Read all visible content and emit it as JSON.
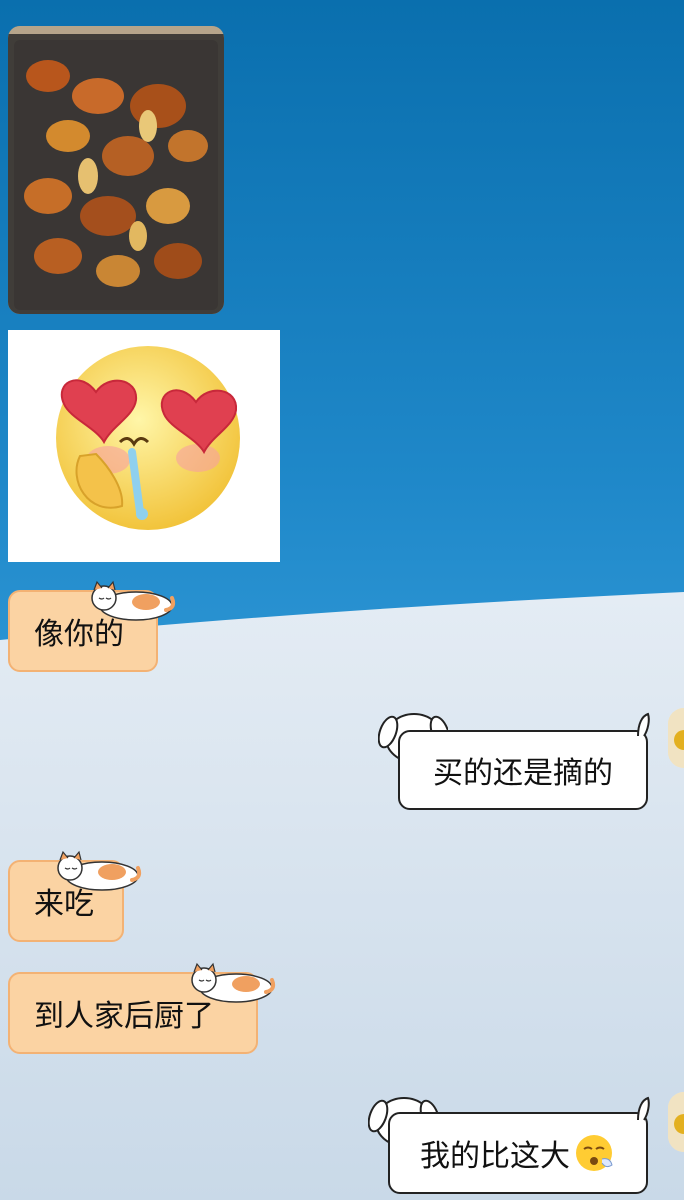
{
  "messages": [
    {
      "id": "m1",
      "side": "left",
      "type": "image",
      "desc_icon": "mushroom-photo"
    },
    {
      "id": "m2",
      "side": "left",
      "type": "sticker",
      "desc_icon": "heart-eyes-drooling-emoji"
    },
    {
      "id": "m3",
      "side": "left",
      "type": "text",
      "text": "像你的"
    },
    {
      "id": "m4",
      "side": "right",
      "type": "text",
      "text": "买的还是摘的"
    },
    {
      "id": "m5",
      "side": "left",
      "type": "text",
      "text": "来吃"
    },
    {
      "id": "m6",
      "side": "left",
      "type": "text",
      "text": "到人家后厨了"
    },
    {
      "id": "m7",
      "side": "right",
      "type": "text",
      "text": "我的比这大",
      "emoji": "😮‍💨"
    }
  ],
  "colors": {
    "left_bubble": "#fbd3a3",
    "left_border": "#f3b274",
    "right_bubble": "#ffffff",
    "right_border": "#222222",
    "sky": "#1f88c9"
  }
}
